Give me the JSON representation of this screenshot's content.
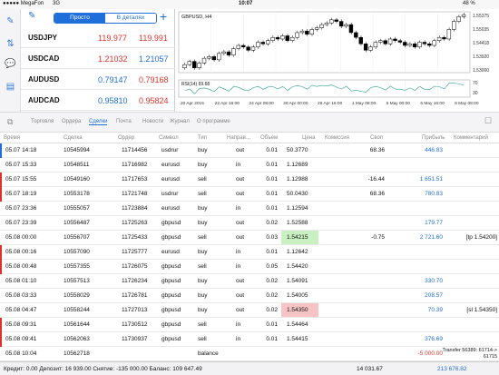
{
  "status": {
    "carrier": "●●●●● MegaFon",
    "net": "3G",
    "time": "10:07",
    "battery": "48 %"
  },
  "quotes": {
    "tab_simple": "Просто",
    "tab_details": "В деталях",
    "rows": [
      {
        "symbol": "USDJPY",
        "bid": "119.977",
        "ask": "119.991",
        "bid_color": "red",
        "ask_color": "red"
      },
      {
        "symbol": "USDCAD",
        "bid": "1.21032",
        "ask": "1.21057",
        "bid_color": "red",
        "ask_color": "blue"
      },
      {
        "symbol": "AUDUSD",
        "bid": "0.79147",
        "ask": "0.79168",
        "bid_color": "blue",
        "ask_color": "red"
      },
      {
        "symbol": "AUDCAD",
        "bid": "0.95810",
        "ask": "0.95824",
        "bid_color": "blue",
        "ask_color": "red"
      }
    ]
  },
  "chart": {
    "title": "GBPUSD, H4",
    "indicator": "RSI(14) 69.68",
    "price_labels": [
      "1.55375",
      "1.55035",
      "1.54418",
      "1.53920",
      "1.53000"
    ],
    "rsi_labels": [
      "70",
      "30"
    ],
    "time_labels": [
      "20 Apr 2015",
      "22 Apr 16:00",
      "24 Apr 08:00",
      "28 Apr 00:00",
      "29 Apr 16:00",
      "1 May 08:00",
      "5 May 00:00",
      "6 May 16:00",
      "8 May 08:00"
    ],
    "candles": [
      1.523,
      1.525,
      1.521,
      1.524,
      1.527,
      1.528,
      1.526,
      1.53,
      1.531,
      1.529,
      1.533,
      1.535,
      1.534,
      1.532,
      1.534,
      1.537,
      1.536,
      1.538,
      1.54,
      1.539,
      1.541,
      1.538,
      1.54,
      1.543,
      1.544,
      1.542,
      1.545,
      1.546,
      1.548,
      1.549,
      1.551,
      1.55,
      1.547,
      1.548,
      1.543,
      1.54,
      1.536,
      1.532,
      1.534,
      1.537,
      1.538,
      1.536,
      1.539,
      1.538,
      1.537,
      1.535,
      1.536,
      1.534,
      1.537,
      1.536,
      1.535,
      1.538,
      1.54,
      1.539,
      1.545,
      1.55,
      1.553,
      1.5542
    ]
  },
  "tabs": [
    "Торговля",
    "Ордера",
    "Сделки",
    "Почта",
    "Новости",
    "Журнал",
    "О программе"
  ],
  "active_tab": "Сделки",
  "headers": [
    "Время",
    "Сделка",
    "Ордер",
    "Символ",
    "Тип",
    "Направ…",
    "Объем",
    "Цена",
    "Комиссия",
    "Своп",
    "Прибыль",
    "Комментарий"
  ],
  "deals": [
    {
      "time": "05.07 14:18",
      "deal": "10545994",
      "order": "11714456",
      "symbol": "usdrur",
      "type": "buy",
      "dir": "out",
      "vol": "0.01",
      "price": "50.3770",
      "comm": "",
      "swap": "68.36",
      "profit": "446.83",
      "comment": "",
      "bar": "blue",
      "hl": ""
    },
    {
      "time": "05.07 15:33",
      "deal": "10548511",
      "order": "11716982",
      "symbol": "eurusd",
      "type": "buy",
      "dir": "in",
      "vol": "0.01",
      "price": "1.12689",
      "comm": "",
      "swap": "",
      "profit": "",
      "comment": "",
      "bar": "",
      "hl": ""
    },
    {
      "time": "05.07 15:55",
      "deal": "10549160",
      "order": "11717653",
      "symbol": "eurusd",
      "type": "sell",
      "dir": "out",
      "vol": "0.01",
      "price": "1.12988",
      "comm": "",
      "swap": "-16.44",
      "profit": "1 651.51",
      "comment": "",
      "bar": "red",
      "hl": ""
    },
    {
      "time": "05.07 18:19",
      "deal": "10553178",
      "order": "11721748",
      "symbol": "usdrur",
      "type": "sell",
      "dir": "out",
      "vol": "0.01",
      "price": "50.0430",
      "comm": "",
      "swap": "68.36",
      "profit": "780.83",
      "comment": "",
      "bar": "red",
      "hl": ""
    },
    {
      "time": "05.07 23:36",
      "deal": "10555057",
      "order": "11723884",
      "symbol": "eurusd",
      "type": "buy",
      "dir": "in",
      "vol": "0.01",
      "price": "1.12594",
      "comm": "",
      "swap": "",
      "profit": "",
      "comment": "",
      "bar": "",
      "hl": ""
    },
    {
      "time": "05.07 23:39",
      "deal": "10556487",
      "order": "11725263",
      "symbol": "gbpusd",
      "type": "buy",
      "dir": "out",
      "vol": "0.02",
      "price": "1.52588",
      "comm": "",
      "swap": "",
      "profit": "179.77",
      "comment": "",
      "bar": "",
      "hl": ""
    },
    {
      "time": "05.08 00:00",
      "deal": "10556707",
      "order": "11725433",
      "symbol": "gbpusd",
      "type": "sell",
      "dir": "out",
      "vol": "0.03",
      "price": "1.54215",
      "comm": "",
      "swap": "-0.75",
      "profit": "2 721.60",
      "comment": "[tp 1.54200]",
      "bar": "",
      "hl": "green"
    },
    {
      "time": "05.08 00:16",
      "deal": "10557090",
      "order": "11725777",
      "symbol": "eurusd",
      "type": "buy",
      "dir": "in",
      "vol": "0.01",
      "price": "1.12642",
      "comm": "",
      "swap": "",
      "profit": "",
      "comment": "",
      "bar": "red",
      "hl": ""
    },
    {
      "time": "05.08 00:48",
      "deal": "10557355",
      "order": "11726075",
      "symbol": "gbpusd",
      "type": "sell",
      "dir": "in",
      "vol": "0.05",
      "price": "1.54420",
      "comm": "",
      "swap": "",
      "profit": "",
      "comment": "",
      "bar": "red",
      "hl": ""
    },
    {
      "time": "05.08 01:10",
      "deal": "10557513",
      "order": "11726234",
      "symbol": "gbpusd",
      "type": "buy",
      "dir": "out",
      "vol": "0.02",
      "price": "1.54091",
      "comm": "",
      "swap": "",
      "profit": "330.70",
      "comment": "",
      "bar": "",
      "hl": ""
    },
    {
      "time": "05.08 03:33",
      "deal": "10558029",
      "order": "11726781",
      "symbol": "gbpusd",
      "type": "buy",
      "dir": "out",
      "vol": "0.02",
      "price": "1.54005",
      "comm": "",
      "swap": "",
      "profit": "208.57",
      "comment": "",
      "bar": "",
      "hl": ""
    },
    {
      "time": "05.08 04:47",
      "deal": "10558244",
      "order": "11727013",
      "symbol": "gbpusd",
      "type": "buy",
      "dir": "out",
      "vol": "0.02",
      "price": "1.54350",
      "comm": "",
      "swap": "",
      "profit": "70.39",
      "comment": "[sl 1.54350]",
      "bar": "",
      "hl": "red"
    },
    {
      "time": "05.08 09:31",
      "deal": "10561644",
      "order": "11730512",
      "symbol": "gbpusd",
      "type": "sell",
      "dir": "in",
      "vol": "0.01",
      "price": "1.54464",
      "comm": "",
      "swap": "",
      "profit": "",
      "comment": "",
      "bar": "red",
      "hl": ""
    },
    {
      "time": "05.08 09:41",
      "deal": "10562063",
      "order": "11730937",
      "symbol": "gbpusd",
      "type": "sell",
      "dir": "in",
      "vol": "0.01",
      "price": "1.54415",
      "comm": "",
      "swap": "",
      "profit": "376.69",
      "comment": "",
      "bar": "red",
      "hl": ""
    },
    {
      "time": "05.08 10:04",
      "deal": "10562718",
      "order": "",
      "symbol": "",
      "type": "balance",
      "dir": "",
      "vol": "",
      "price": "",
      "comm": "",
      "swap": "",
      "profit": "-5 000.00",
      "comment": "Transfer 56389: 61714-> 61715",
      "bar": "",
      "hl": ""
    }
  ],
  "footer": {
    "summary": "Кредит: 0.00 Депозит: 16 939.00 Снятие: -135 000.00 Баланс: 109 647.49",
    "swap_total": "14 031.67",
    "profit_total": "213 676.82"
  },
  "colors": {
    "accent": "#1e6fd9",
    "loss": "#e0322b",
    "green_hl": "#c9f0c0",
    "red_hl": "#f6c4c4"
  }
}
